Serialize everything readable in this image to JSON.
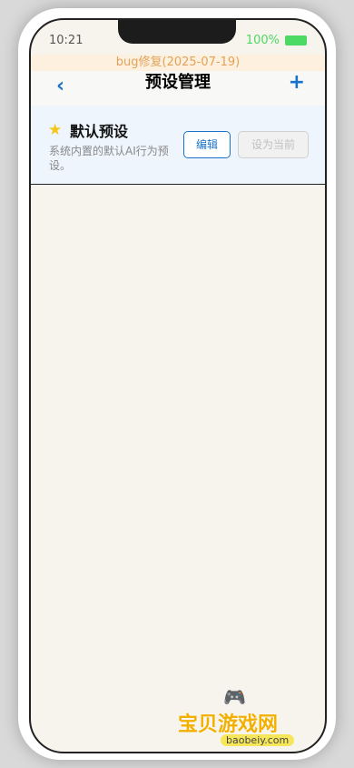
{
  "status_bar": {
    "time": "10:21",
    "battery_percent": "100%"
  },
  "banner": {
    "text": "bug修复(2025-07-19)"
  },
  "nav": {
    "back_icon": "‹",
    "title": "预设管理",
    "add_icon": "+"
  },
  "presets": [
    {
      "icon": "★",
      "name": "默认预设",
      "description": "系统内置的默认AI行为预设。",
      "edit_label": "编辑",
      "set_current_label": "设为当前"
    }
  ],
  "watermark": {
    "logo_icon": "🎮",
    "title": "宝贝游戏网",
    "url": "baobeiy.com"
  },
  "colors": {
    "accent": "#1a73c9",
    "star": "#f5c518",
    "battery": "#4cd964",
    "banner_text": "#e1a35a"
  }
}
